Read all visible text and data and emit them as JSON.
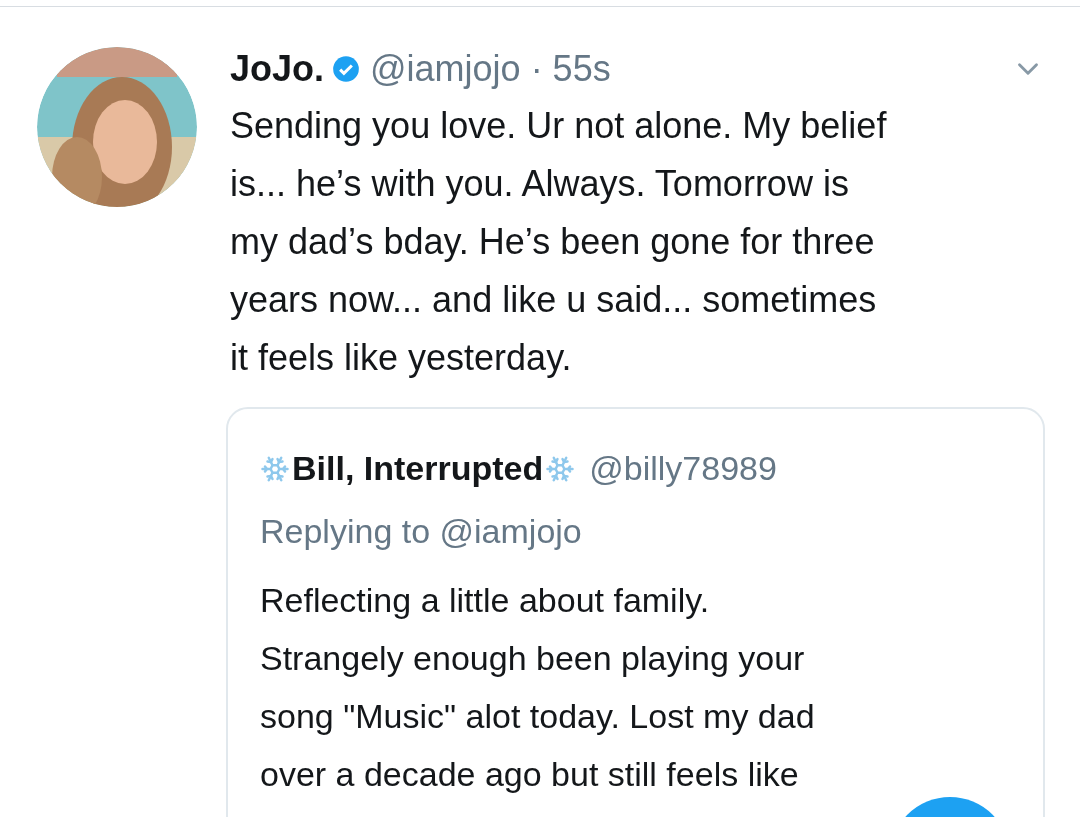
{
  "tweet": {
    "name": "JoJo.",
    "verified": true,
    "handle": "@iamjojo · 55s",
    "lines": [
      "Sending you love. Ur not alone. My belief",
      "is... he’s with you. Always. Tomorrow is",
      "my dad’s bday. He’s been gone for three",
      "years now... and like u said... sometimes",
      "it feels like yesterday."
    ],
    "quote": {
      "name": "Bill, Interrupted",
      "handle": "@billy78989",
      "replying": "Replying to @iamjojo",
      "lines": [
        "Reflecting a little about family.",
        "Strangely enough been playing your",
        "song \"Music\" alot today. Lost my dad",
        "over a decade ago but still feels like"
      ]
    }
  }
}
